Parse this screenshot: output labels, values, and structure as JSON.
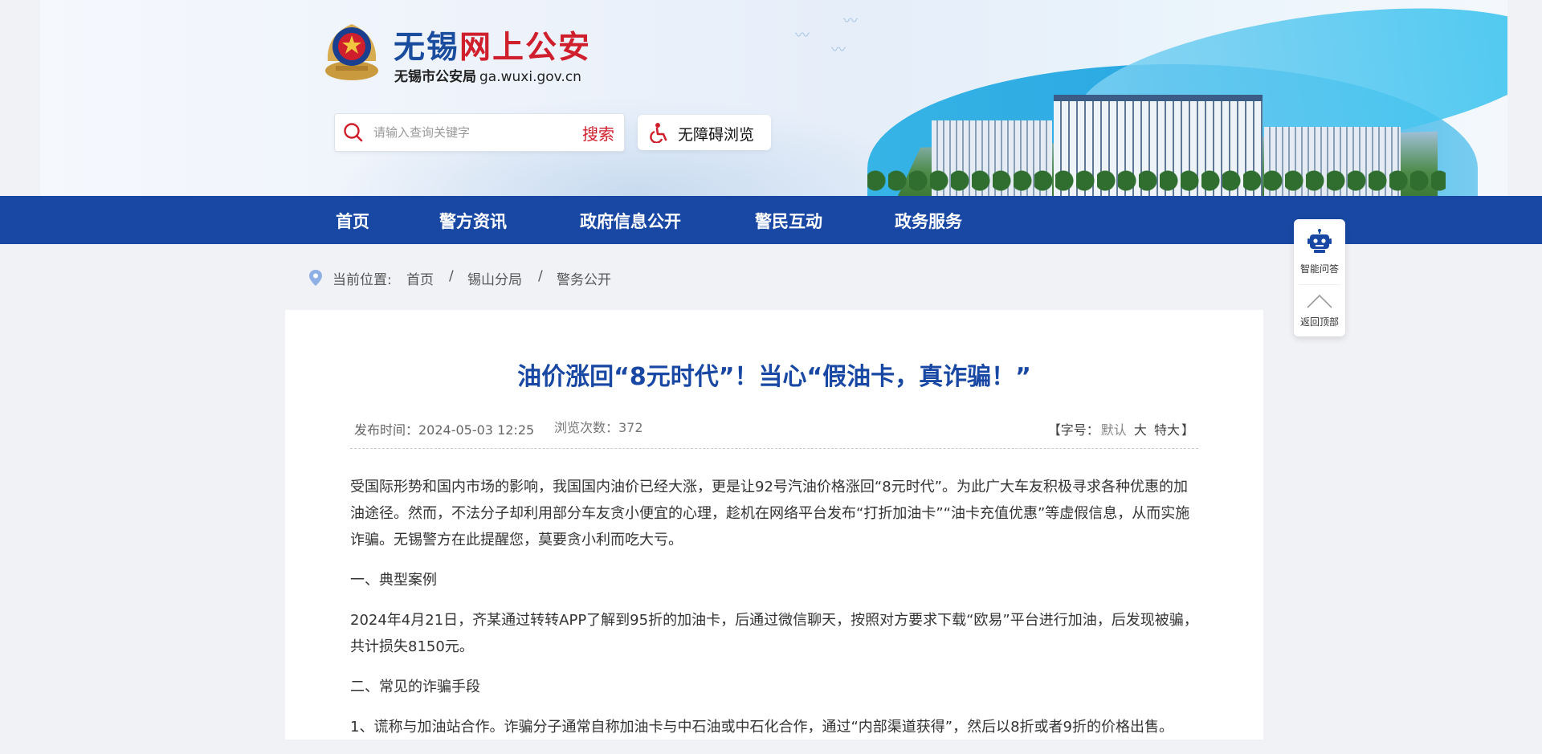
{
  "header": {
    "title_part1": "无锡",
    "title_part2": "网上公安",
    "subtitle": "无锡市公安局",
    "domain": "ga.wuxi.gov.cn"
  },
  "search": {
    "placeholder": "请输入查询关键字",
    "button": "搜索"
  },
  "accessibility": {
    "label": "无障碍浏览"
  },
  "nav": {
    "items": [
      "首页",
      "警方资讯",
      "政府信息公开",
      "警民互动",
      "政务服务"
    ]
  },
  "breadcrumb": {
    "label": "当前位置:",
    "items": [
      "首页",
      "锡山分局",
      "警务公开"
    ],
    "separator": "/"
  },
  "article": {
    "title": "油价涨回“8元时代”！当心“假油卡，真诈骗！”",
    "publish_time": "发布时间：2024-05-03 12:25",
    "views": "浏览次数：372",
    "font_ctrl": {
      "open": "【字号：",
      "options": [
        "默认",
        "大",
        "特大"
      ],
      "close": "】"
    },
    "paragraphs": [
      "受国际形势和国内市场的影响，我国国内油价已经大涨，更是让92号汽油价格涨回“8元时代”。为此广大车友积极寻求各种优惠的加油途径。然而，不法分子却利用部分车友贪小便宜的心理，趁机在网络平台发布“打折加油卡”“油卡充值优惠”等虚假信息，从而实施诈骗。无锡警方在此提醒您，莫要贪小利而吃大亏。",
      "一、典型案例",
      "2024年4月21日，齐某通过转转APP了解到95折的加油卡，后通过微信聊天，按照对方要求下载“欧易”平台进行加油，后发现被骗，共计损失8150元。",
      "二、常见的诈骗手段",
      "1、谎称与加油站合作。诈骗分子通常自称加油卡与中石油或中石化合作，通过“内部渠道获得”，然后以8折或者9折的价格出售。"
    ]
  },
  "side_widget": {
    "qa_label": "智能问答",
    "top_label": "返回顶部"
  },
  "colors": {
    "brand_blue": "#1848a3",
    "brand_red": "#d01f2c",
    "page_bg": "#f1f2f6"
  }
}
